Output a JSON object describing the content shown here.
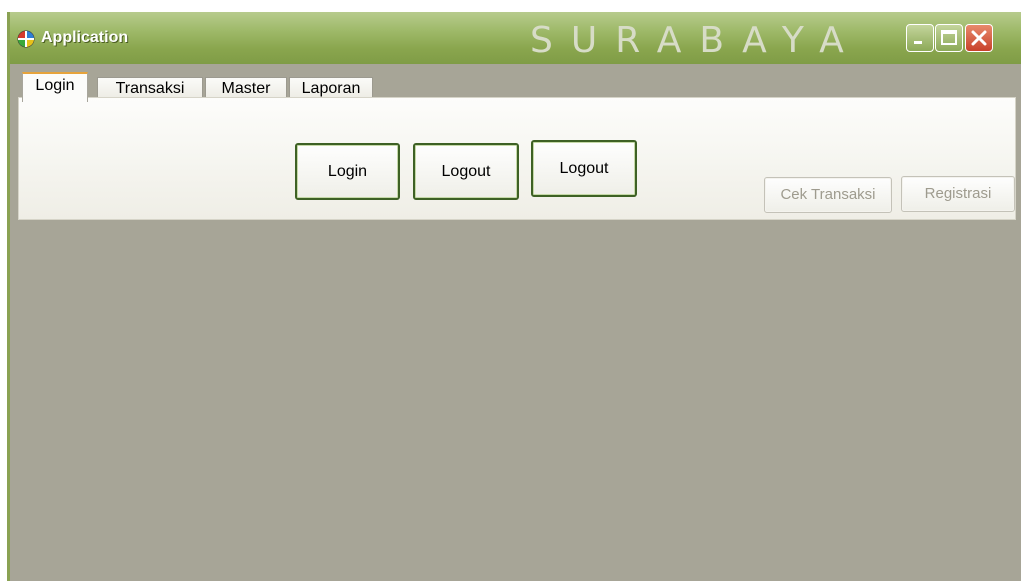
{
  "window": {
    "title": "Application",
    "watermark": "SURABAYA"
  },
  "tabs": [
    {
      "label": "Login",
      "active": true
    },
    {
      "label": "Transaksi",
      "active": false
    },
    {
      "label": "Master",
      "active": false
    },
    {
      "label": "Laporan",
      "active": false
    }
  ],
  "toolbar": {
    "login_label": "Login",
    "logout_label": "Logout",
    "logout2_label": "Logout",
    "cek_transaksi_label": "Cek Transaksi",
    "registrasi_label": "Registrasi"
  },
  "icons": {
    "app": "app-icon",
    "minimize": "minimize-icon",
    "maximize": "maximize-icon",
    "close": "close-icon"
  },
  "colors": {
    "titlebar": "#8aa64e",
    "client_area": "#a7a597",
    "button_border": "#3e6125",
    "close_button": "#c8412a"
  }
}
